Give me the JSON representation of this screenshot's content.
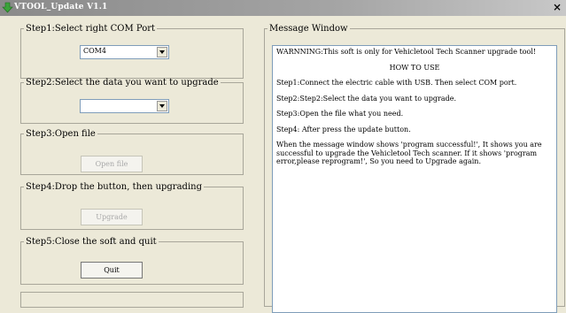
{
  "window": {
    "title": "VTOOL_Update V1.1",
    "close_glyph": "×"
  },
  "step1": {
    "legend": "Step1:Select right COM Port",
    "combo_value": "COM4"
  },
  "step2": {
    "legend": "Step2:Select the data you want to upgrade",
    "combo_value": ""
  },
  "step3": {
    "legend": "Step3:Open file",
    "button": "Open file"
  },
  "step4": {
    "legend": "Step4:Drop the button, then upgrading",
    "button": "Upgrade"
  },
  "step5": {
    "legend": "Step5:Close the soft and quit",
    "button": "Quit"
  },
  "message": {
    "legend": "Message Window",
    "lines": [
      "WARNNING:This soft is only for Vehicletool Tech Scanner upgrade tool!",
      "HOW TO USE",
      "Step1:Connect the electric cable with USB. Then select COM port.",
      "Step2:Step2:Select the data you want to upgrade.",
      "Step3:Open the file what you need.",
      "Step4: After press the update button.",
      "When the message window shows 'program successful!', It shows you are successful to upgrade the Vehicletool Tech scanner. If it shows 'program error,please reprogram!', So you need to Upgrade again."
    ]
  },
  "colors": {
    "titlebar": "#a0a0a0",
    "face": "#ece9d8"
  }
}
